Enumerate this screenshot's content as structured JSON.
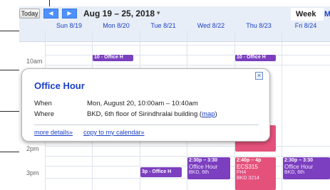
{
  "toolbar": {
    "today_label": "Today",
    "prev_label": "◀",
    "next_label": "▶",
    "date_range": "Aug 19 – 25, 2018",
    "range_caret": "▾",
    "week_label": "Week",
    "month_label": "M"
  },
  "days": [
    "Sun 8/19",
    "Mon 8/20",
    "Tue 8/21",
    "Wed 8/22",
    "Thu 8/23",
    "Fri 8/24"
  ],
  "times": [
    "10am",
    "2pm",
    "3pm"
  ],
  "events": {
    "mon_10": "10 - Office H",
    "thu_10": "10 - Office H",
    "tue_3": "3p - Office H",
    "wed_230_time": "2:30p – 3:30",
    "wed_230_title": "Office Hour",
    "wed_230_loc": "BKD, 6th",
    "thu_240_time": "2:40p – 4p",
    "thu_240_title": "ECS315",
    "thu_240_room": "FH4",
    "thu_240_loc": "BKD 3214",
    "fri_230_time": "2:30p – 3:30",
    "fri_230_title": "Office Hour",
    "fri_230_loc": "BKD, 6th"
  },
  "popup": {
    "title": "Office Hour",
    "close_label": "×",
    "when_label": "When",
    "when_value": "Mon, August 20, 10:00am – 10:40am",
    "where_label": "Where",
    "where_value": "BKD, 6th floor of Sirindhralai building (",
    "map_link": "map",
    "where_close": ")",
    "more_details": "more details»",
    "copy_link": "copy to my calendar»"
  },
  "colors": {
    "event_purple": "#7b3fbf",
    "event_pink": "#e4527b",
    "link_blue": "#1a3fc5",
    "header_bg": "#e8eef7"
  }
}
